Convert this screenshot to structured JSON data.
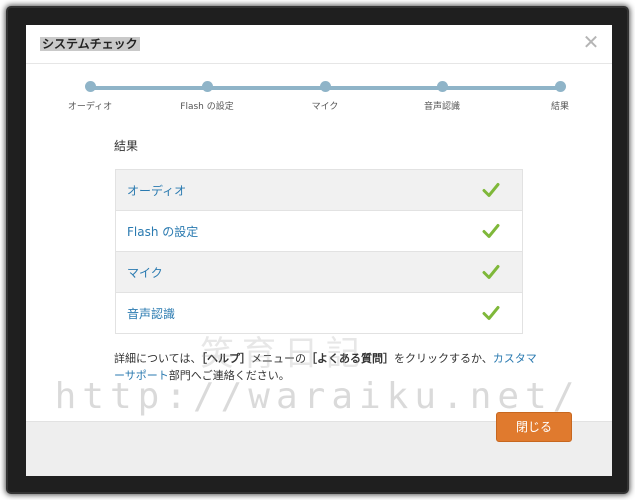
{
  "dialog": {
    "title": "システムチェック",
    "close_glyph": "✕"
  },
  "steps": [
    {
      "label": "オーディオ"
    },
    {
      "label": "Flash の設定"
    },
    {
      "label": "マイク"
    },
    {
      "label": "音声認識"
    },
    {
      "label": "結果"
    }
  ],
  "results": {
    "heading": "結果",
    "rows": [
      {
        "label": "オーディオ",
        "status": "ok"
      },
      {
        "label": "Flash の設定",
        "status": "ok"
      },
      {
        "label": "マイク",
        "status": "ok"
      },
      {
        "label": "音声認識",
        "status": "ok"
      }
    ]
  },
  "help": {
    "part1": "詳細については、",
    "help_menu": "［ヘルプ］",
    "part2": "メニューの",
    "faq": "［よくある質問］",
    "part3": "をクリックするか、",
    "support_link": "カスタマーサポート",
    "part4": "部門へご連絡ください。"
  },
  "footer": {
    "close_button": "閉じる"
  },
  "watermark": {
    "url": "http://waraiku.net/",
    "blog_name": "笑育日記"
  },
  "colors": {
    "accent": "#2a7ab0",
    "check": "#7fb83a",
    "button": "#e07a2e",
    "stepper": "#8fb4c8"
  }
}
